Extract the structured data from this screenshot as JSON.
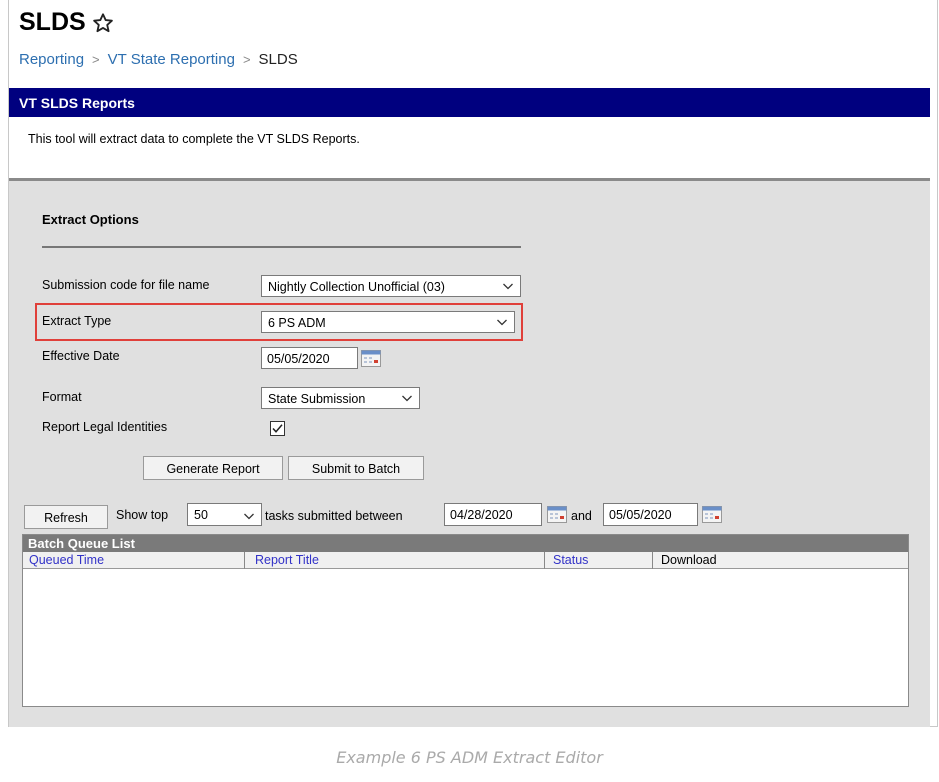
{
  "page": {
    "title": "SLDS",
    "breadcrumb": [
      "Reporting",
      "VT State Reporting",
      "SLDS"
    ]
  },
  "panel": {
    "header": "VT SLDS Reports",
    "description": "This tool will extract data to complete the VT SLDS Reports."
  },
  "extract": {
    "heading": "Extract Options",
    "submission_label": "Submission code for file name",
    "submission_value": "Nightly Collection Unofficial (03)",
    "type_label": "Extract Type",
    "type_value": "6 PS ADM",
    "date_label": "Effective Date",
    "date_value": "05/05/2020",
    "format_label": "Format",
    "format_value": "State Submission",
    "legal_label": "Report Legal Identities",
    "legal_checked": true,
    "generate_label": "Generate Report",
    "submit_label": "Submit to Batch"
  },
  "batch": {
    "refresh_label": "Refresh",
    "show_top_label": "Show top",
    "show_top_value": "50",
    "between_label": "tasks submitted between",
    "start_date": "04/28/2020",
    "and_label": "and",
    "end_date": "05/05/2020",
    "list_title": "Batch Queue List",
    "columns": [
      "Queued Time",
      "Report Title",
      "Status",
      "Download"
    ]
  },
  "caption": "Example 6 PS ADM Extract Editor",
  "colors": {
    "header_blue": "#00007f",
    "highlight_red": "#e0403a",
    "link_blue": "#2d6fb0"
  }
}
